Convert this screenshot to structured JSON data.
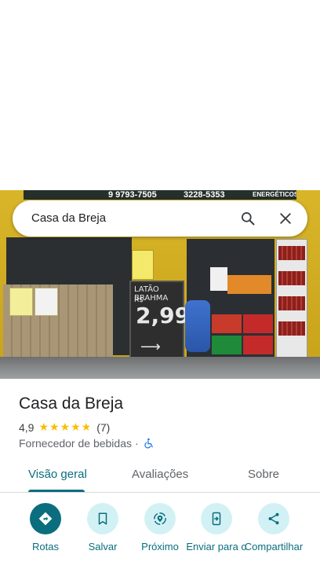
{
  "search": {
    "query": "Casa da Breja"
  },
  "photo": {
    "sign_phone_1": "9 9793-7505",
    "sign_phone_2": "3228-5353",
    "sign_right": "ENERGÉTICOS",
    "chalk_line": "LATÃO BRAHMA",
    "chalk_price": "2,99",
    "chalk_unit": "R$"
  },
  "place": {
    "title": "Casa da Breja",
    "rating": "4,9",
    "stars": "★★★★★",
    "review_count": "(7)",
    "category": "Fornecedor de bebidas",
    "separator": "·"
  },
  "tabs": [
    {
      "label": "Visão geral",
      "active": true
    },
    {
      "label": "Avaliações"
    },
    {
      "label": "Sobre"
    }
  ],
  "actions": [
    {
      "label": "Rotas",
      "icon": "directions-icon"
    },
    {
      "label": "Salvar",
      "icon": "bookmark-icon"
    },
    {
      "label": "Próximo",
      "icon": "nearby-icon"
    },
    {
      "label": "Enviar para o",
      "icon": "send-to-phone-icon"
    },
    {
      "label": "Compartilhar",
      "icon": "share-icon"
    }
  ],
  "colors": {
    "accent": "#0a6e7e",
    "action_bg": "#d2f1f5",
    "star": "#fbbc04"
  }
}
